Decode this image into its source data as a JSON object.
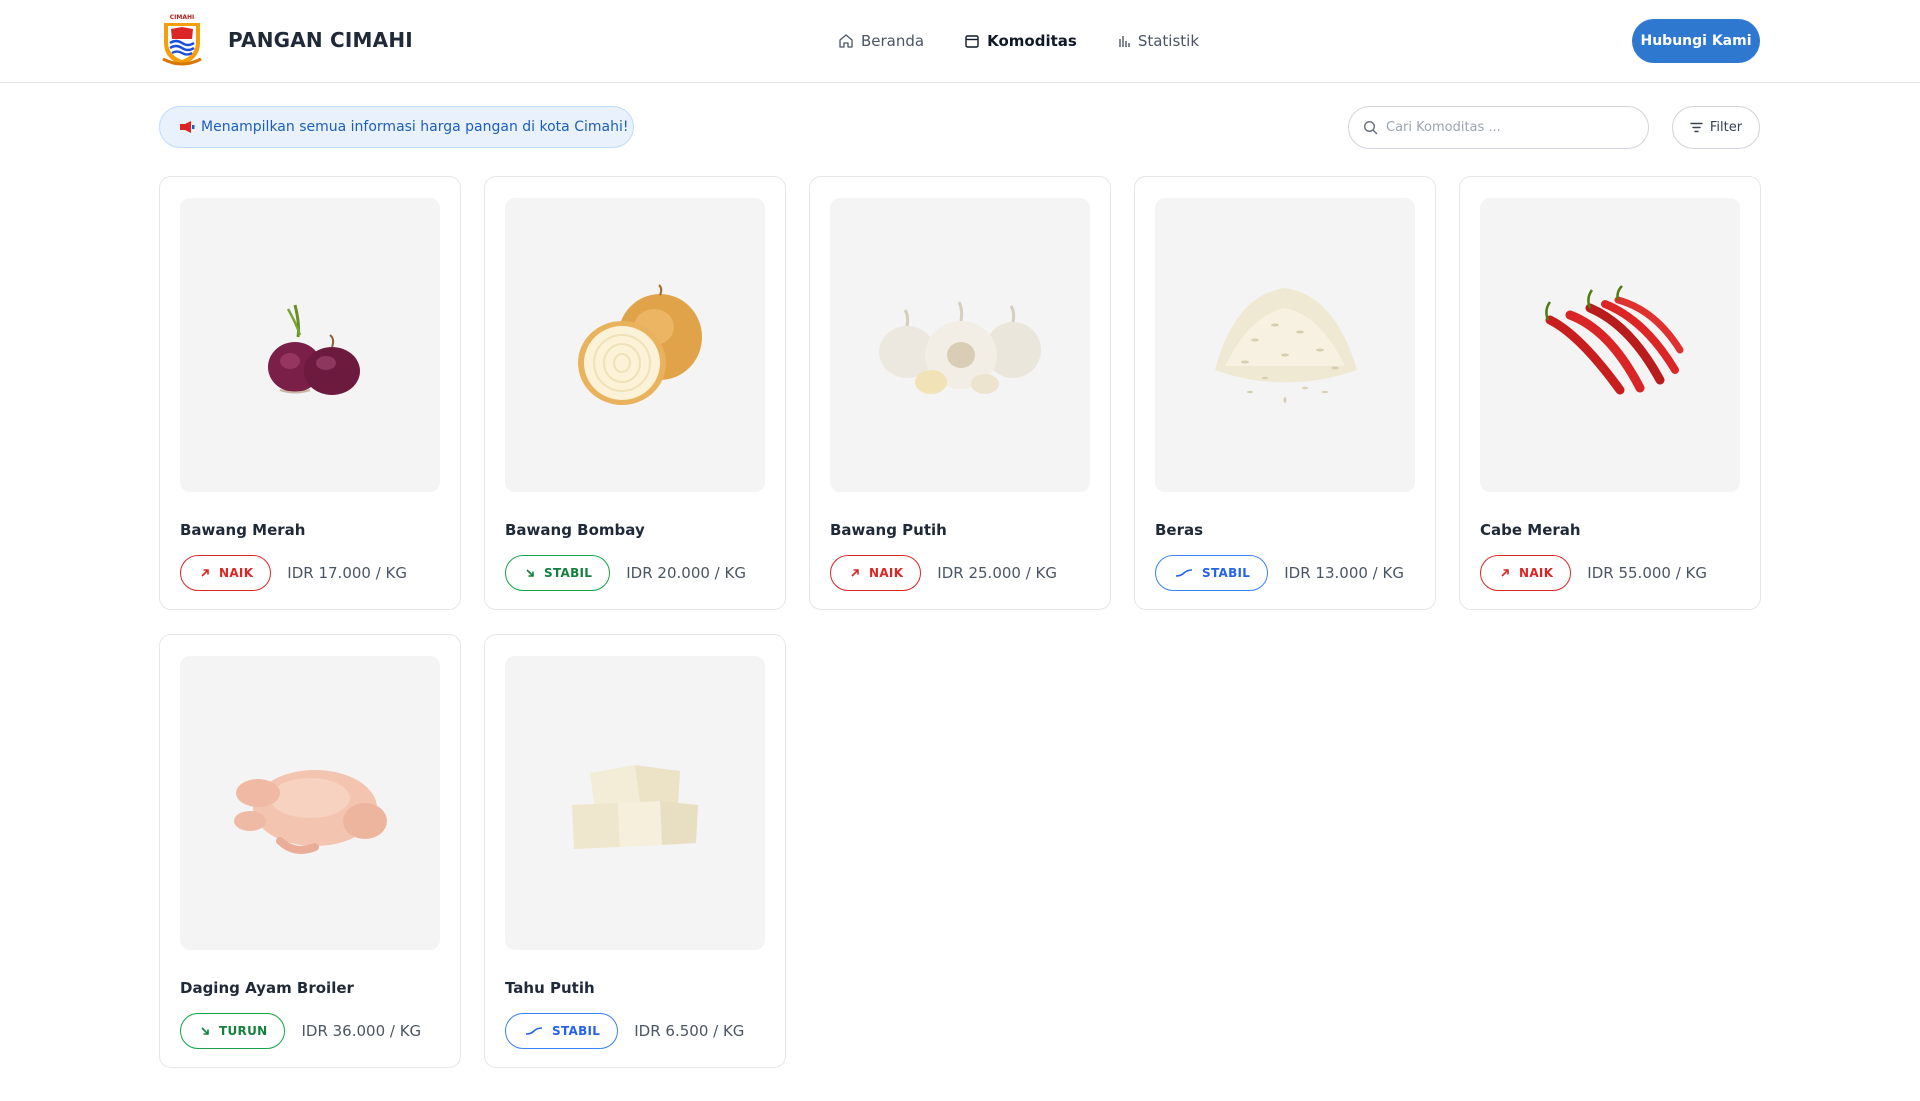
{
  "header": {
    "brand": "PANGAN CIMAHI",
    "logo_text": "CIMAHI",
    "nav": [
      {
        "label": "Beranda",
        "icon": "home-icon"
      },
      {
        "label": "Komoditas",
        "icon": "box-icon"
      },
      {
        "label": "Statistik",
        "icon": "bar-chart-icon"
      }
    ],
    "contact_label": "Hubungi Kami"
  },
  "toolbar": {
    "info_text": "Menampilkan semua informasi harga pangan di kota Cimahi!",
    "search_placeholder": "Cari Komoditas ...",
    "filter_label": "Filter"
  },
  "colors": {
    "accent": "#2f78cf",
    "up": "#dc2626",
    "down": "#15803d",
    "stable": "#2563eb"
  },
  "products": [
    {
      "name": "Bawang Merah",
      "status": "NAIK",
      "price": "IDR 17.000 / KG",
      "image": "red-onion"
    },
    {
      "name": "Bawang Bombay",
      "status": "STABIL",
      "price": "IDR 20.000 / KG",
      "image": "onion"
    },
    {
      "name": "Bawang Putih",
      "status": "NAIK",
      "price": "IDR 25.000 / KG",
      "image": "garlic"
    },
    {
      "name": "Beras",
      "status": "STABIL",
      "price": "IDR 13.000 / KG",
      "image": "rice"
    },
    {
      "name": "Cabe Merah",
      "status": "NAIK",
      "price": "IDR 55.000 / KG",
      "image": "red-chili"
    },
    {
      "name": "Daging Ayam Broiler",
      "status": "TURUN",
      "price": "IDR 36.000 / KG",
      "image": "chicken"
    },
    {
      "name": "Tahu Putih",
      "status": "STABIL",
      "price": "IDR 6.500 / KG",
      "image": "tofu"
    }
  ]
}
